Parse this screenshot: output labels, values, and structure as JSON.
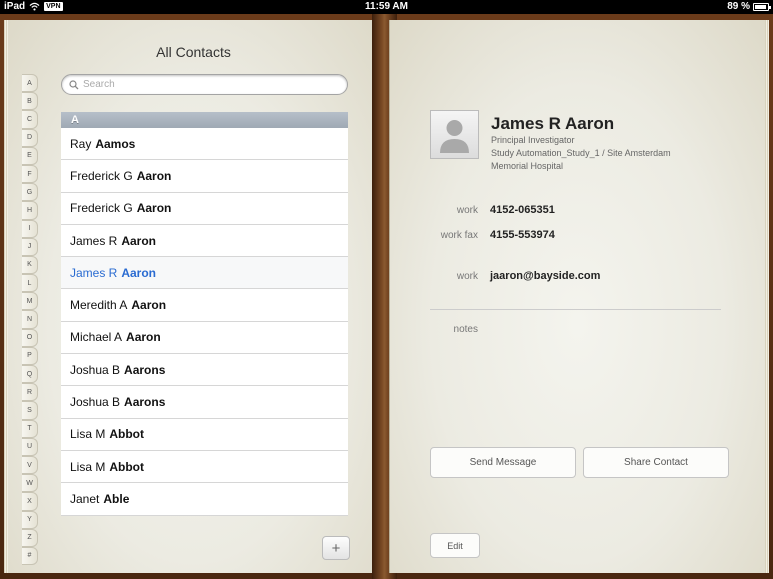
{
  "status_bar": {
    "device": "iPad",
    "vpn": "VPN",
    "time": "11:59 AM",
    "battery": "89 %"
  },
  "contacts_list": {
    "title": "All Contacts",
    "search_placeholder": "Search",
    "index_letters": [
      "A",
      "B",
      "C",
      "D",
      "E",
      "F",
      "G",
      "H",
      "I",
      "J",
      "K",
      "L",
      "M",
      "N",
      "O",
      "P",
      "Q",
      "R",
      "S",
      "T",
      "U",
      "V",
      "W",
      "X",
      "Y",
      "Z",
      "#"
    ],
    "section_header": "A",
    "rows": [
      {
        "first": "Ray",
        "last": "Aamos",
        "selected": false
      },
      {
        "first": "Frederick G",
        "last": "Aaron",
        "selected": false
      },
      {
        "first": "Frederick G",
        "last": "Aaron",
        "selected": false
      },
      {
        "first": "James R",
        "last": "Aaron",
        "selected": false
      },
      {
        "first": "James R",
        "last": "Aaron",
        "selected": true
      },
      {
        "first": "Meredith A",
        "last": "Aaron",
        "selected": false
      },
      {
        "first": "Michael A",
        "last": "Aaron",
        "selected": false
      },
      {
        "first": "Joshua B",
        "last": "Aarons",
        "selected": false
      },
      {
        "first": "Joshua B",
        "last": "Aarons",
        "selected": false
      },
      {
        "first": "Lisa M",
        "last": "Abbot",
        "selected": false
      },
      {
        "first": "Lisa M",
        "last": "Abbot",
        "selected": false
      },
      {
        "first": "Janet",
        "last": "Able",
        "selected": false
      }
    ],
    "add_label": "+"
  },
  "contact_detail": {
    "name": "James R Aaron",
    "job_title": "Principal Investigator",
    "organization_line1": "Study Automation_Study_1 / Site Amsterdam",
    "organization_line2": "Memorial Hospital",
    "phones": [
      {
        "label": "work",
        "value": "4152-065351"
      },
      {
        "label": "work fax",
        "value": "4155-553974"
      }
    ],
    "email": {
      "label": "work",
      "value": "jaaron@bayside.com"
    },
    "notes_label": "notes",
    "send_message_label": "Send Message",
    "share_contact_label": "Share Contact",
    "edit_label": "Edit"
  }
}
